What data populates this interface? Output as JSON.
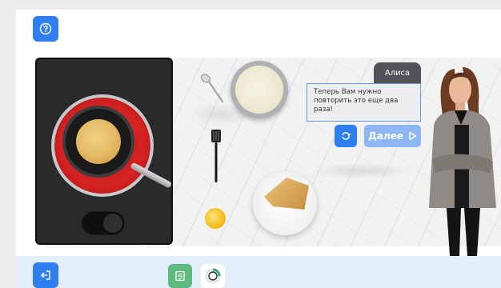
{
  "toolbar": {
    "help_icon": "question-circle-icon",
    "exit_icon": "exit-icon",
    "notes_icon": "notebook-icon",
    "progress_icon": "progress-ring-icon",
    "progress_fraction": 0.25
  },
  "scene": {
    "items": [
      "stove",
      "frying-pan",
      "pancake",
      "batter-bowl",
      "spoon",
      "spatula",
      "plate-with-pancakes",
      "oil-dish"
    ]
  },
  "dialog": {
    "speaker": "Алиса",
    "message": "Теперь Вам нужно повторить это еще два раза!",
    "repeat_icon": "repeat-icon",
    "next_label": "Далее",
    "next_icon": "play-arrow-icon"
  },
  "colors": {
    "accent": "#2f7ff1",
    "accent_disabled": "#8db7f4",
    "green": "#5fba7d",
    "bottom_bar": "#e3eefb"
  }
}
